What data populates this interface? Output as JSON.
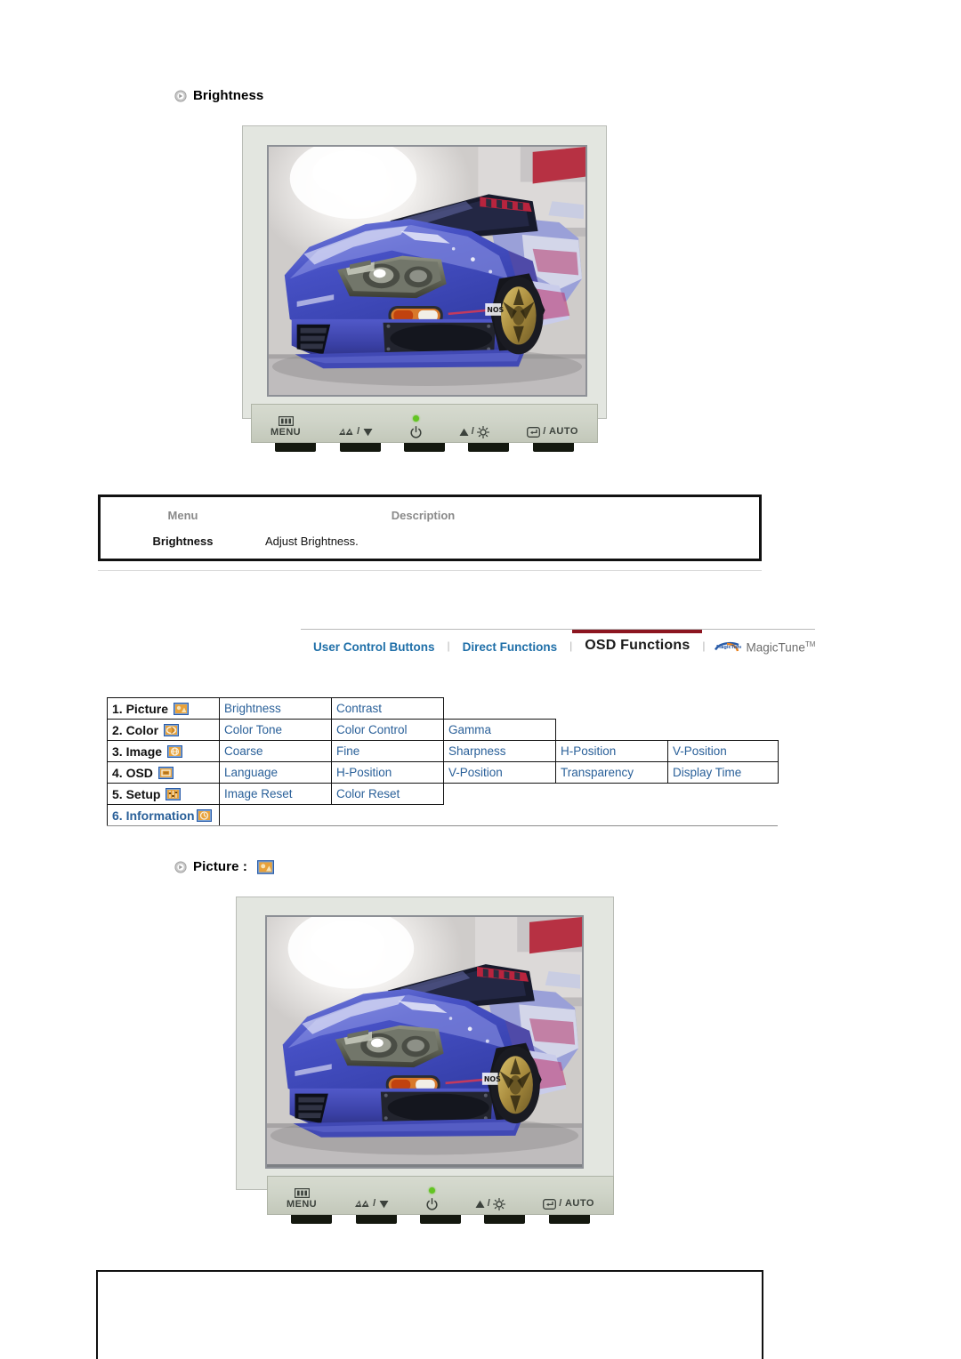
{
  "page": {
    "section1_heading": "Brightness",
    "section2_heading": "Picture :"
  },
  "monitor": {
    "controls": [
      {
        "name": "menu",
        "label": "MENU",
        "icon": "osd-menu-icon"
      },
      {
        "name": "source-down",
        "label": "",
        "icon": "source-down-icon"
      },
      {
        "name": "power",
        "label": "",
        "icon": "power-icon"
      },
      {
        "name": "up-brightness",
        "label": "",
        "icon": "up-brightness-icon"
      },
      {
        "name": "enter-auto",
        "label": "/ AUTO",
        "icon": "enter-auto-icon"
      }
    ],
    "power_led_color": "#63c423",
    "screen_image": "blue-sports-car-showroom"
  },
  "description_table": {
    "headers": [
      "Menu",
      "Description"
    ],
    "rows": [
      {
        "menu": "Brightness",
        "description": "Adjust Brightness."
      }
    ]
  },
  "tabs": {
    "items": [
      {
        "label": "User Control Buttons",
        "active": false
      },
      {
        "label": "Direct Functions",
        "active": false
      },
      {
        "label": "OSD Functions",
        "active": true
      }
    ],
    "separator": "|",
    "magictune": {
      "label": "MagicTune",
      "trademark": "TM",
      "logo_text": "MagicTune"
    },
    "active_underline_color": "#8c1520",
    "link_color": "#1f6fa8"
  },
  "osd_table": {
    "link_color": "#2a6099",
    "rows": [
      {
        "label": "1. Picture",
        "icon": "picture-icon",
        "label_blue": false,
        "items": [
          "Brightness",
          "Contrast"
        ]
      },
      {
        "label": "2. Color",
        "icon": "color-icon",
        "label_blue": false,
        "items": [
          "Color Tone",
          "Color Control",
          "Gamma"
        ]
      },
      {
        "label": "3. Image",
        "icon": "image-icon",
        "label_blue": false,
        "items": [
          "Coarse",
          "Fine",
          "Sharpness",
          "H-Position",
          "V-Position"
        ]
      },
      {
        "label": "4. OSD",
        "icon": "osd-icon",
        "label_blue": false,
        "items": [
          "Language",
          "H-Position",
          "V-Position",
          "Transparency",
          "Display Time"
        ]
      },
      {
        "label": "5. Setup",
        "icon": "setup-icon",
        "label_blue": false,
        "items": [
          "Image Reset",
          "Color Reset"
        ]
      },
      {
        "label": "6. Information",
        "icon": "information-icon",
        "label_blue": true,
        "items": []
      }
    ]
  }
}
